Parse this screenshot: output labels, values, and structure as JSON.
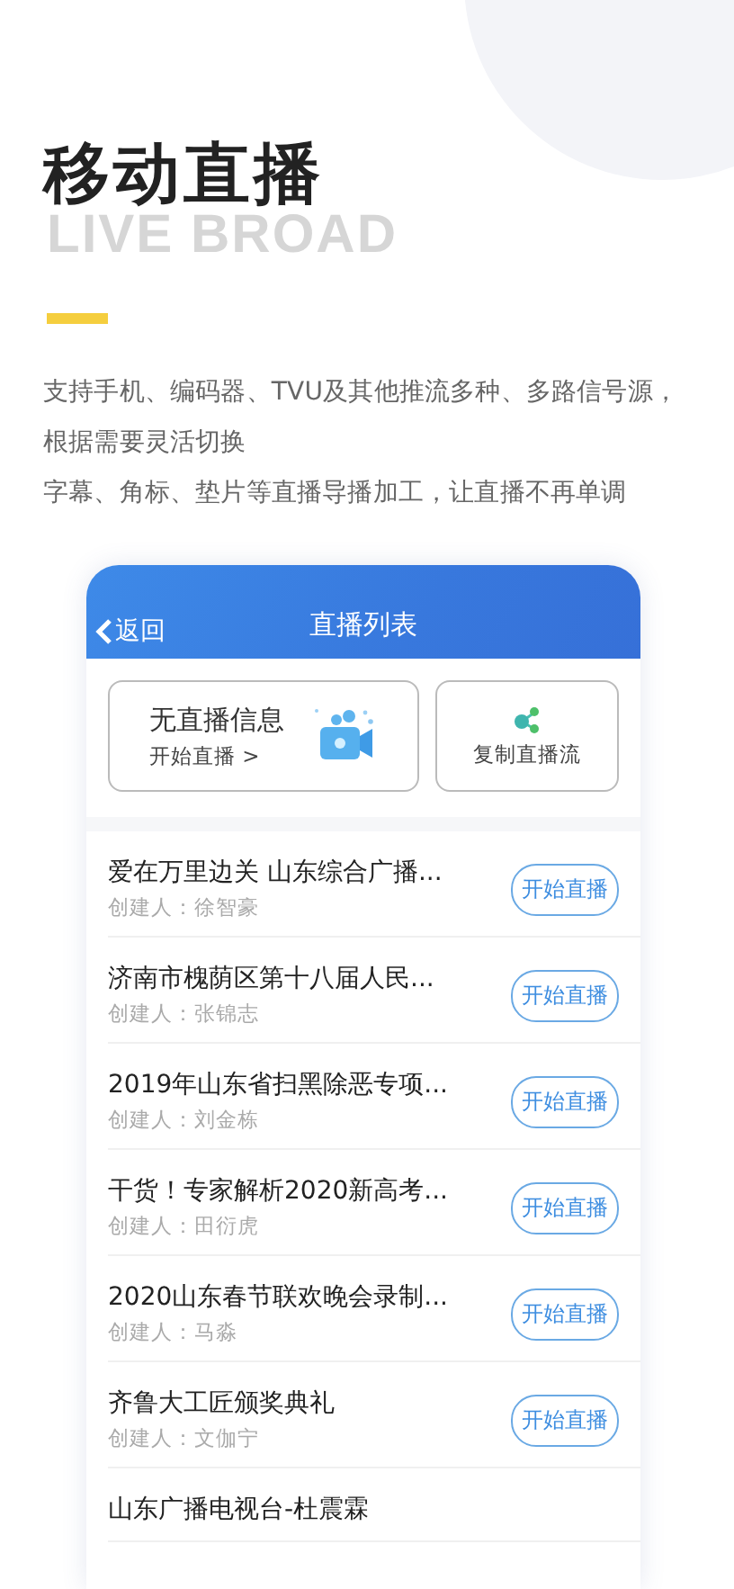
{
  "heading": "移动直播",
  "ghost_text": "LIVE BROAD",
  "description": [
    "支持手机、编码器、TVU及其他推流多种、多路信号源，根据需要灵活切换",
    "字幕、角标、垫片等直播导播加工，让直播不再单调"
  ],
  "phone": {
    "back": "返回",
    "title": "直播列表",
    "status_card": {
      "title": "无直播信息",
      "action": "开始直播 >"
    },
    "copy_card": {
      "label": "复制直播流"
    },
    "rows": [
      {
        "title": "爱在万里边关 山东综合广播...",
        "creator": "创建人：徐智豪",
        "button": "开始直播"
      },
      {
        "title": "济南市槐荫区第十八届人民...",
        "creator": "创建人：张锦志",
        "button": "开始直播"
      },
      {
        "title": "2019年山东省扫黑除恶专项...",
        "creator": "创建人：刘金栋",
        "button": "开始直播"
      },
      {
        "title": "干货！专家解析2020新高考...",
        "creator": "创建人：田衍虎",
        "button": "开始直播"
      },
      {
        "title": "2020山东春节联欢晚会录制...",
        "creator": "创建人：马淼",
        "button": "开始直播"
      },
      {
        "title": "齐鲁大工匠颁奖典礼",
        "creator": "创建人：文伽宁",
        "button": "开始直播"
      },
      {
        "title": "山东广播电视台-杜震霖"
      }
    ]
  }
}
